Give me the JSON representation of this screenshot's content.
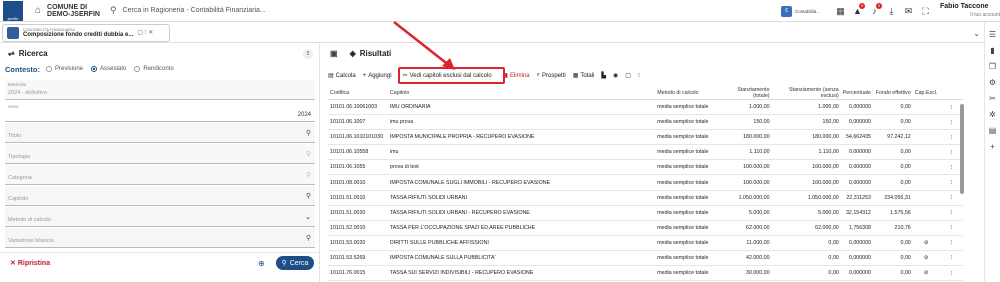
{
  "topbar": {
    "org_line1": "COMUNE DI",
    "org_line2": "DEMO-JSERFIN",
    "search_placeholder": "Cerca in Ragioneria - Contabilità Finanziaria...",
    "app_label": "Contabilità...",
    "bell1_count": "9",
    "bell2_count": "0",
    "user_name": "Fabio Taccone",
    "user_sub": "Il tuo account"
  },
  "tab": {
    "line1": "CONTABILITÀ FINANZIARIA",
    "line2": "Composizione fondo crediti dubbia e..."
  },
  "left": {
    "title": "Ricerca",
    "context_label": "Contesto:",
    "radios": [
      "Previsione",
      "Assestato",
      "Rendiconto"
    ],
    "selected_radio": "Assestato",
    "fields": [
      {
        "label": "Esercizio",
        "value": "2024 - definitivo"
      },
      {
        "label": "Anno",
        "value": "2024"
      },
      {
        "label": "Titolo",
        "value": ""
      },
      {
        "label": "Tipologia",
        "value": ""
      },
      {
        "label": "Categoria",
        "value": ""
      },
      {
        "label": "Capitolo",
        "value": ""
      },
      {
        "label": "Metodo di calcolo",
        "value": ""
      },
      {
        "label": "Variazione bilancio",
        "value": ""
      }
    ],
    "reset_label": "Ripristina",
    "search_label": "Cerca"
  },
  "right": {
    "title": "Risultati",
    "toolbar": {
      "calcola": "Calcola",
      "aggiungi": "Aggiungi",
      "vedi": "Vedi capitoli esclusi dal calcolo",
      "elimina": "Elimina",
      "prospetti": "Prospetti",
      "totali": "Totali"
    },
    "columns": [
      "Codifica",
      "Capitolo",
      "Metodo di calcolo",
      "Stanziamento (totale)",
      "Stanziamento (senza esclusi)",
      "Percentuale",
      "Fondo effettivo",
      "Cap.Escl."
    ],
    "rows": [
      {
        "cod": "10101.06.10061003",
        "cap": "IMU ORDINARIA",
        "met": "media semplice totale",
        "st": "1.000,00",
        "se": "1.000,00",
        "pc": "0,000000",
        "fe": "0,00",
        "ex": ""
      },
      {
        "cod": "10101.06.1007",
        "cap": "imu prova",
        "met": "media semplice totale",
        "st": "150,00",
        "se": "150,00",
        "pc": "0,000000",
        "fe": "0,00",
        "ex": ""
      },
      {
        "cod": "10101.06.1010101030",
        "cap": "IMPOSTA MUNICIPALE PROPRIA - RECUPERO EVASIONE",
        "met": "media semplice totale",
        "st": "180.000,00",
        "se": "180.000,00",
        "pc": "54,662435",
        "fe": "97.242,12",
        "ex": ""
      },
      {
        "cod": "10101.06.10558",
        "cap": "imu",
        "met": "media semplice totale",
        "st": "1.110,00",
        "se": "1.110,00",
        "pc": "0,000000",
        "fe": "0,00",
        "ex": ""
      },
      {
        "cod": "10101.06.1055",
        "cap": "prova di test",
        "met": "media semplice totale",
        "st": "100.000,00",
        "se": "100.000,00",
        "pc": "0,000000",
        "fe": "0,00",
        "ex": ""
      },
      {
        "cod": "10101.08.0010",
        "cap": "IMPOSTA COMUNALE SUGLI IMMOBILI - RECUPERO EVASIONE",
        "met": "media semplice totale",
        "st": "100.000,00",
        "se": "100.000,00",
        "pc": "0,000000",
        "fe": "0,00",
        "ex": ""
      },
      {
        "cod": "10101.51.0010",
        "cap": "TASSA RIFIUTI SOLIDI URBANI",
        "met": "media semplice totale",
        "st": "1.050.000,00",
        "se": "1.050.000,00",
        "pc": "22,311253",
        "fe": "234.055,31",
        "ex": ""
      },
      {
        "cod": "10101.51.0020",
        "cap": "TASSA RIFIUTI SOLIDI URBANI - RECUPERO EVASIONE",
        "met": "media semplice totale",
        "st": "5.000,00",
        "se": "5.000,00",
        "pc": "32,154312",
        "fe": "1.575,56",
        "ex": ""
      },
      {
        "cod": "10101.52.0010",
        "cap": "TASSA PER L'OCCUPAZIONE SPAZI ED AREE PUBBLICHE",
        "met": "media semplice totale",
        "st": "62.000,00",
        "se": "62.000,00",
        "pc": "1,756308",
        "fe": "210,76",
        "ex": ""
      },
      {
        "cod": "10101.53.0020",
        "cap": "DIRITTI SULLE PUBBLICHE AFFISSIONI",
        "met": "media semplice totale",
        "st": "11.000,00",
        "se": "0,00",
        "pc": "0,000000",
        "fe": "0,00",
        "ex": "⊘"
      },
      {
        "cod": "10101.53.5269",
        "cap": "IMPOSTA COMUNALE SULLA PUBBLICITA'",
        "met": "media semplice totale",
        "st": "42.000,00",
        "se": "0,00",
        "pc": "0,000000",
        "fe": "0,00",
        "ex": "⊘"
      },
      {
        "cod": "10101.76.0015",
        "cap": "TASSA SUI SERVIZI INDIVISIBILI - RECUPERO EVASIONE",
        "met": "media semplice totale",
        "st": "30.000,00",
        "se": "0,00",
        "pc": "0,000000",
        "fe": "0,00",
        "ex": "⊘"
      }
    ]
  },
  "colors": {
    "brand": "#1d4e89",
    "danger": "#c02030",
    "highlight": "#d9262c"
  }
}
